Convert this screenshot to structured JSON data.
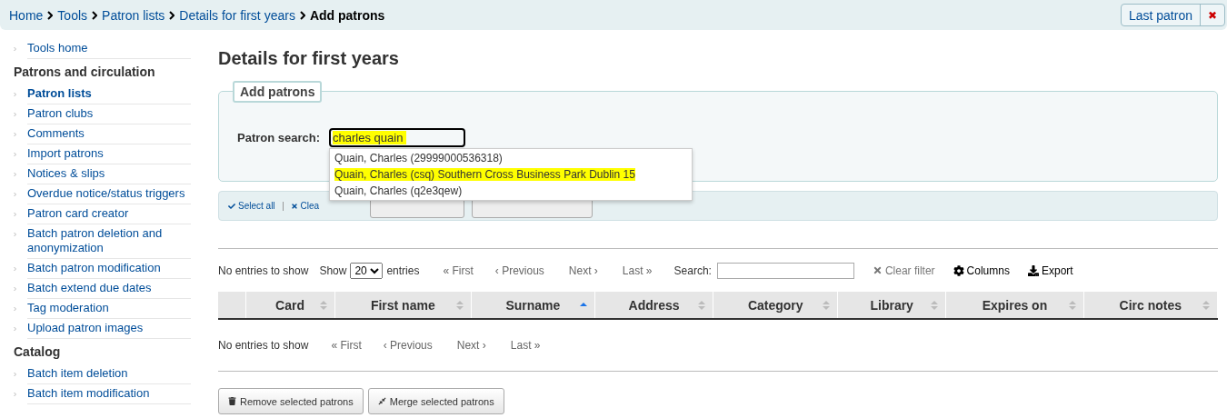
{
  "breadcrumbs": [
    {
      "label": "Home",
      "current": false
    },
    {
      "label": "Tools",
      "current": false
    },
    {
      "label": "Patron lists",
      "current": false
    },
    {
      "label": "Details for first years",
      "current": false
    },
    {
      "label": "Add patrons",
      "current": true
    }
  ],
  "header_buttons": {
    "last_patron": "Last patron",
    "close": "✖"
  },
  "sidebar": {
    "sections": [
      {
        "items": [
          {
            "label": "Tools home",
            "selected": false
          }
        ]
      },
      {
        "heading": "Patrons and circulation",
        "items": [
          {
            "label": "Patron lists",
            "selected": true
          },
          {
            "label": "Patron clubs",
            "selected": false
          },
          {
            "label": "Comments",
            "selected": false
          },
          {
            "label": "Import patrons",
            "selected": false
          },
          {
            "label": "Notices & slips",
            "selected": false
          },
          {
            "label": "Overdue notice/status triggers",
            "selected": false
          },
          {
            "label": "Patron card creator",
            "selected": false
          },
          {
            "label": "Batch patron deletion and anonymization",
            "selected": false
          },
          {
            "label": "Batch patron modification",
            "selected": false
          },
          {
            "label": "Batch extend due dates",
            "selected": false
          },
          {
            "label": "Tag moderation",
            "selected": false
          },
          {
            "label": "Upload patron images",
            "selected": false
          }
        ]
      },
      {
        "heading": "Catalog",
        "items": [
          {
            "label": "Batch item deletion",
            "selected": false
          },
          {
            "label": "Batch item modification",
            "selected": false
          }
        ]
      }
    ]
  },
  "page_title": "Details for first years",
  "add_patrons": {
    "legend": "Add patrons",
    "label": "Patron search:",
    "value": "charles quain",
    "value_highlighted": true,
    "suggestions": [
      {
        "label": "Quain, Charles (29999000536318)",
        "highlighted": false
      },
      {
        "label": "Quain, Charles (csq) Southern Cross Business Park Dublin 15",
        "highlighted": true
      },
      {
        "label": "Quain, Charles (q2e3qew)",
        "highlighted": false
      }
    ]
  },
  "action_bar": {
    "select_all": "Select all",
    "clear_all": "Clea"
  },
  "table_controls": {
    "info": "No entries to show",
    "show": "Show",
    "page_size": "20",
    "entries": "entries",
    "first": "« First",
    "previous": "‹ Previous",
    "next": "Next ›",
    "last": "Last »",
    "search_label": "Search:",
    "clear_filter": "Clear filter",
    "columns": "Columns",
    "export": "Export"
  },
  "table": {
    "columns": [
      {
        "label": "Card",
        "sorted": false
      },
      {
        "label": "First name",
        "sorted": false
      },
      {
        "label": "Surname",
        "sorted": true
      },
      {
        "label": "Address",
        "sorted": false
      },
      {
        "label": "Category",
        "sorted": false
      },
      {
        "label": "Library",
        "sorted": false
      },
      {
        "label": "Expires on",
        "sorted": false
      },
      {
        "label": "Circ notes",
        "sorted": false
      }
    ]
  },
  "bottom_pager": {
    "info": "No entries to show",
    "first": "« First",
    "previous": "‹ Previous",
    "next": "Next ›",
    "last": "Last »"
  },
  "buttons": [
    {
      "kind": "remove",
      "label": "Remove selected patrons"
    },
    {
      "kind": "merge",
      "label": "Merge selected patrons"
    }
  ]
}
